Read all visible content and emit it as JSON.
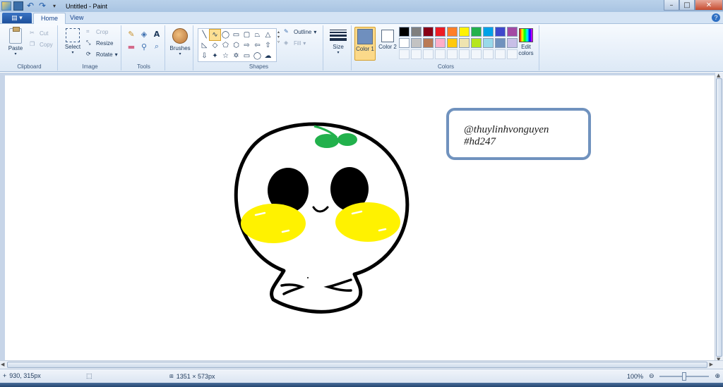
{
  "titlebar": {
    "title": "Untitled - Paint",
    "minimize": "–",
    "maximize": "□",
    "close": "✕"
  },
  "tabs": {
    "file": "▤ ▾",
    "home": "Home",
    "view": "View",
    "help": "?"
  },
  "ribbon": {
    "clipboard": {
      "label": "Clipboard",
      "paste": "Paste",
      "cut": "Cut",
      "copy": "Copy"
    },
    "image": {
      "label": "Image",
      "select": "Select",
      "crop": "Crop",
      "resize": "Resize",
      "rotate": "Rotate"
    },
    "tools": {
      "label": "Tools"
    },
    "brushes": {
      "label": "Brushes"
    },
    "shapes": {
      "label": "Shapes",
      "outline": "Outline",
      "fill": "Fill"
    },
    "size": {
      "label": "Size"
    },
    "colors": {
      "label": "Colors",
      "color1": "Color 1",
      "color2": "Color 2",
      "edit": "Edit colors",
      "color1_value": "#6f8fbe",
      "color2_value": "#ffffff",
      "palette_row1": [
        "#000000",
        "#7f7f7f",
        "#880015",
        "#ed1c24",
        "#ff7f27",
        "#fff200",
        "#22b14c",
        "#00a2e8",
        "#3f48cc",
        "#a349a4"
      ],
      "palette_row2": [
        "#ffffff",
        "#c3c3c3",
        "#b97a57",
        "#ffaec9",
        "#ffc90e",
        "#efe4b0",
        "#b5e61d",
        "#99d9ea",
        "#7092be",
        "#c8bfe7"
      ]
    }
  },
  "canvas": {
    "watermark_line1": "@thuylinhvonguyen",
    "watermark_line2": "#hd247",
    "colors": {
      "outline": "#000000",
      "cheek": "#fff200",
      "leaf": "#22b14c",
      "frame": "#7092be"
    }
  },
  "status": {
    "cursor": "930, 315px",
    "size": "1351 × 573px",
    "zoom": "100%"
  }
}
